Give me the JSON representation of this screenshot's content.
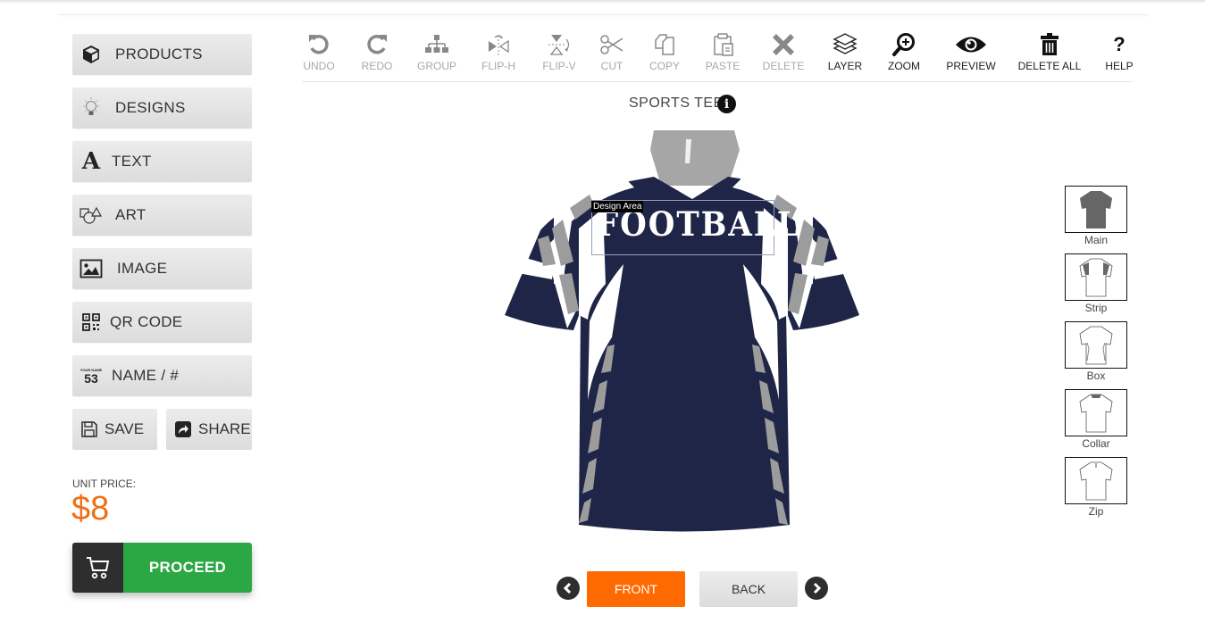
{
  "sidebar": {
    "items": [
      {
        "label": "PRODUCTS",
        "icon": "cube-icon"
      },
      {
        "label": "DESIGNS",
        "icon": "lightbulb-icon"
      },
      {
        "label": "TEXT",
        "icon": "text-a-icon"
      },
      {
        "label": "ART",
        "icon": "shapes-icon"
      },
      {
        "label": "IMAGE",
        "icon": "image-icon"
      },
      {
        "label": "QR CODE",
        "icon": "qr-code-icon"
      },
      {
        "label": "NAME / #",
        "icon": "name-number-icon",
        "icon_top_text": "YOUR NAME",
        "icon_number": "53"
      }
    ],
    "save_label": "SAVE",
    "share_label": "SHARE",
    "price_label": "UNIT PRICE:",
    "price_value": "$8",
    "proceed_label": "PROCEED"
  },
  "toolbar": {
    "items": [
      {
        "label": "UNDO",
        "icon": "undo-icon",
        "enabled": false
      },
      {
        "label": "REDO",
        "icon": "redo-icon",
        "enabled": false
      },
      {
        "label": "GROUP",
        "icon": "group-icon",
        "enabled": false
      },
      {
        "label": "FLIP-H",
        "icon": "flip-horizontal-icon",
        "enabled": false
      },
      {
        "label": "FLIP-V",
        "icon": "flip-vertical-icon",
        "enabled": false
      },
      {
        "label": "CUT",
        "icon": "scissors-icon",
        "enabled": false
      },
      {
        "label": "COPY",
        "icon": "copy-icon",
        "enabled": false
      },
      {
        "label": "PASTE",
        "icon": "paste-icon",
        "enabled": false
      },
      {
        "label": "DELETE",
        "icon": "delete-x-icon",
        "enabled": false
      },
      {
        "label": "LAYER",
        "icon": "layers-icon",
        "enabled": true
      },
      {
        "label": "ZOOM",
        "icon": "zoom-in-icon",
        "enabled": true
      },
      {
        "label": "PREVIEW",
        "icon": "eye-icon",
        "enabled": true
      },
      {
        "label": "DELETE ALL",
        "icon": "trash-icon",
        "enabled": true
      },
      {
        "label": "HELP",
        "icon": "question-icon",
        "enabled": true
      }
    ]
  },
  "canvas": {
    "product_title": "SPORTS TEE",
    "info_glyph": "i",
    "design_area_label": "Design Area",
    "design_text": "FOOTBALL",
    "colors": {
      "main": "#1f2547",
      "strip": "#9c9c9c",
      "box": "#ffffff",
      "collar": "#a6a6a6"
    }
  },
  "parts": [
    {
      "label": "Main"
    },
    {
      "label": "Strip"
    },
    {
      "label": "Box"
    },
    {
      "label": "Collar"
    },
    {
      "label": "Zip"
    }
  ],
  "view_nav": {
    "front_label": "FRONT",
    "back_label": "BACK",
    "active": "FRONT"
  },
  "colors": {
    "accent": "#ff6a00",
    "price": "#ee6f16",
    "proceed": "#2ba743",
    "cart_bg": "#2e2e2e"
  }
}
